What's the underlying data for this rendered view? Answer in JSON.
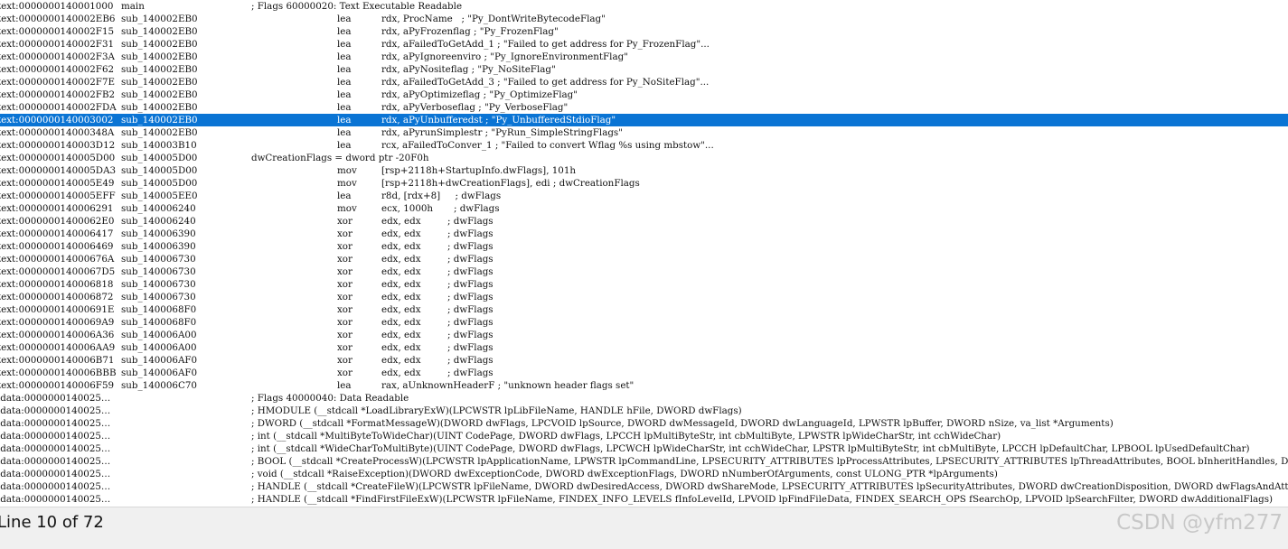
{
  "listing": [
    {
      "kind": "comment",
      "addr": "text:0000000140001000",
      "func": "main",
      "text": "; Flags 60000020: Text Executable Readable"
    },
    {
      "kind": "instr",
      "addr": "text:0000000140002EB6",
      "func": "sub_140002EB0",
      "mnem": "lea",
      "ops": "rdx, ProcName   ; \"Py_DontWriteBytecodeFlag\""
    },
    {
      "kind": "instr",
      "addr": "text:0000000140002F15",
      "func": "sub_140002EB0",
      "mnem": "lea",
      "ops": "rdx, aPyFrozenflag ; \"Py_FrozenFlag\""
    },
    {
      "kind": "instr",
      "addr": "text:0000000140002F31",
      "func": "sub_140002EB0",
      "mnem": "lea",
      "ops": "rdx, aFailedToGetAdd_1 ; \"Failed to get address for Py_FrozenFlag\"..."
    },
    {
      "kind": "instr",
      "addr": "text:0000000140002F3A",
      "func": "sub_140002EB0",
      "mnem": "lea",
      "ops": "rdx, aPyIgnoreenviro ; \"Py_IgnoreEnvironmentFlag\""
    },
    {
      "kind": "instr",
      "addr": "text:0000000140002F62",
      "func": "sub_140002EB0",
      "mnem": "lea",
      "ops": "rdx, aPyNositeflag ; \"Py_NoSiteFlag\""
    },
    {
      "kind": "instr",
      "addr": "text:0000000140002F7E",
      "func": "sub_140002EB0",
      "mnem": "lea",
      "ops": "rdx, aFailedToGetAdd_3 ; \"Failed to get address for Py_NoSiteFlag\"..."
    },
    {
      "kind": "instr",
      "addr": "text:0000000140002FB2",
      "func": "sub_140002EB0",
      "mnem": "lea",
      "ops": "rdx, aPyOptimizeflag ; \"Py_OptimizeFlag\""
    },
    {
      "kind": "instr",
      "addr": "text:0000000140002FDA",
      "func": "sub_140002EB0",
      "mnem": "lea",
      "ops": "rdx, aPyVerboseflag ; \"Py_VerboseFlag\""
    },
    {
      "kind": "instr",
      "selected": true,
      "addr": "text:0000000140003002",
      "func": "sub_140002EB0",
      "mnem": "lea",
      "ops": "rdx, aPyUnbufferedst ; \"Py_UnbufferedStdioFlag\""
    },
    {
      "kind": "instr",
      "addr": "text:000000014000348A",
      "func": "sub_140002EB0",
      "mnem": "lea",
      "ops": "rdx, aPyrunSimplestr ; \"PyRun_SimpleStringFlags\""
    },
    {
      "kind": "instr",
      "addr": "text:0000000140003D12",
      "func": "sub_140003B10",
      "mnem": "lea",
      "ops": "rcx, aFailedToConver_1 ; \"Failed to convert Wflag %s using mbstow\"..."
    },
    {
      "kind": "comment",
      "addr": "text:0000000140005D00",
      "func": "sub_140005D00",
      "text": "dwCreationFlags = dword ptr -20F0h"
    },
    {
      "kind": "instr",
      "addr": "text:0000000140005DA3",
      "func": "sub_140005D00",
      "mnem": "mov",
      "ops": "[rsp+2118h+StartupInfo.dwFlags], 101h"
    },
    {
      "kind": "instr",
      "addr": "text:0000000140005E49",
      "func": "sub_140005D00",
      "mnem": "mov",
      "ops": "[rsp+2118h+dwCreationFlags], edi ; dwCreationFlags"
    },
    {
      "kind": "instr",
      "addr": "text:0000000140005EFF",
      "func": "sub_140005EE0",
      "mnem": "lea",
      "ops": "r8d, [rdx+8]     ; dwFlags"
    },
    {
      "kind": "instr",
      "addr": "text:0000000140006291",
      "func": "sub_140006240",
      "mnem": "mov",
      "ops": "ecx, 1000h       ; dwFlags"
    },
    {
      "kind": "instr",
      "addr": "text:00000001400062E0",
      "func": "sub_140006240",
      "mnem": "xor",
      "ops": "edx, edx         ; dwFlags"
    },
    {
      "kind": "instr",
      "addr": "text:0000000140006417",
      "func": "sub_140006390",
      "mnem": "xor",
      "ops": "edx, edx         ; dwFlags"
    },
    {
      "kind": "instr",
      "addr": "text:0000000140006469",
      "func": "sub_140006390",
      "mnem": "xor",
      "ops": "edx, edx         ; dwFlags"
    },
    {
      "kind": "instr",
      "addr": "text:000000014000676A",
      "func": "sub_140006730",
      "mnem": "xor",
      "ops": "edx, edx         ; dwFlags"
    },
    {
      "kind": "instr",
      "addr": "text:00000001400067D5",
      "func": "sub_140006730",
      "mnem": "xor",
      "ops": "edx, edx         ; dwFlags"
    },
    {
      "kind": "instr",
      "addr": "text:0000000140006818",
      "func": "sub_140006730",
      "mnem": "xor",
      "ops": "edx, edx         ; dwFlags"
    },
    {
      "kind": "instr",
      "addr": "text:0000000140006872",
      "func": "sub_140006730",
      "mnem": "xor",
      "ops": "edx, edx         ; dwFlags"
    },
    {
      "kind": "instr",
      "addr": "text:000000014000691E",
      "func": "sub_1400068F0",
      "mnem": "xor",
      "ops": "edx, edx         ; dwFlags"
    },
    {
      "kind": "instr",
      "addr": "text:00000001400069A9",
      "func": "sub_1400068F0",
      "mnem": "xor",
      "ops": "edx, edx         ; dwFlags"
    },
    {
      "kind": "instr",
      "addr": "text:0000000140006A36",
      "func": "sub_140006A00",
      "mnem": "xor",
      "ops": "edx, edx         ; dwFlags"
    },
    {
      "kind": "instr",
      "addr": "text:0000000140006AA9",
      "func": "sub_140006A00",
      "mnem": "xor",
      "ops": "edx, edx         ; dwFlags"
    },
    {
      "kind": "instr",
      "addr": "text:0000000140006B71",
      "func": "sub_140006AF0",
      "mnem": "xor",
      "ops": "edx, edx         ; dwFlags"
    },
    {
      "kind": "instr",
      "addr": "text:0000000140006BBB",
      "func": "sub_140006AF0",
      "mnem": "xor",
      "ops": "edx, edx         ; dwFlags"
    },
    {
      "kind": "instr",
      "addr": "text:0000000140006F59",
      "func": "sub_140006C70",
      "mnem": "lea",
      "ops": "rax, aUnknownHeaderF ; \"unknown header flags set\""
    },
    {
      "kind": "comment",
      "addr": "idata:0000000140025…",
      "func": "",
      "text": "; Flags 40000040: Data Readable"
    },
    {
      "kind": "comment",
      "addr": "idata:0000000140025…",
      "func": "",
      "text": "; HMODULE (__stdcall *LoadLibraryExW)(LPCWSTR lpLibFileName, HANDLE hFile, DWORD dwFlags)"
    },
    {
      "kind": "comment",
      "addr": "idata:0000000140025…",
      "func": "",
      "text": "; DWORD (__stdcall *FormatMessageW)(DWORD dwFlags, LPCVOID lpSource, DWORD dwMessageId, DWORD dwLanguageId, LPWSTR lpBuffer, DWORD nSize, va_list *Arguments)"
    },
    {
      "kind": "comment",
      "addr": "idata:0000000140025…",
      "func": "",
      "text": "; int (__stdcall *MultiByteToWideChar)(UINT CodePage, DWORD dwFlags, LPCCH lpMultiByteStr, int cbMultiByte, LPWSTR lpWideCharStr, int cchWideChar)"
    },
    {
      "kind": "comment",
      "addr": "idata:0000000140025…",
      "func": "",
      "text": "; int (__stdcall *WideCharToMultiByte)(UINT CodePage, DWORD dwFlags, LPCWCH lpWideCharStr, int cchWideChar, LPSTR lpMultiByteStr, int cbMultiByte, LPCCH lpDefaultChar, LPBOOL lpUsedDefaultChar)"
    },
    {
      "kind": "comment",
      "addr": "idata:0000000140025…",
      "func": "",
      "text": "; BOOL (__stdcall *CreateProcessW)(LPCWSTR lpApplicationName, LPWSTR lpCommandLine, LPSECURITY_ATTRIBUTES lpProcessAttributes, LPSECURITY_ATTRIBUTES lpThreadAttributes, BOOL bInheritHandles, DWORD dwCreationFlags)"
    },
    {
      "kind": "comment",
      "addr": "idata:0000000140025…",
      "func": "",
      "text": "; void (__stdcall *RaiseException)(DWORD dwExceptionCode, DWORD dwExceptionFlags, DWORD nNumberOfArguments, const ULONG_PTR *lpArguments)"
    },
    {
      "kind": "comment",
      "addr": "idata:0000000140025…",
      "func": "",
      "text": "; HANDLE (__stdcall *CreateFileW)(LPCWSTR lpFileName, DWORD dwDesiredAccess, DWORD dwShareMode, LPSECURITY_ATTRIBUTES lpSecurityAttributes, DWORD dwCreationDisposition, DWORD dwFlagsAndAttributes)"
    },
    {
      "kind": "comment",
      "addr": "idata:0000000140025…",
      "func": "",
      "text": "; HANDLE (__stdcall *FindFirstFileExW)(LPCWSTR lpFileName, FINDEX_INFO_LEVELS fInfoLevelId, LPVOID lpFindFileData, FINDEX_SEARCH_OPS fSearchOp, LPVOID lpSearchFilter, DWORD dwAdditionalFlags)"
    }
  ],
  "status": {
    "line_info": "Line 10 of 72"
  },
  "watermark": "CSDN @yfm277",
  "colors": {
    "selection": "#0a74d4",
    "background": "#ffffff",
    "statusbar": "#f0f0f0"
  }
}
